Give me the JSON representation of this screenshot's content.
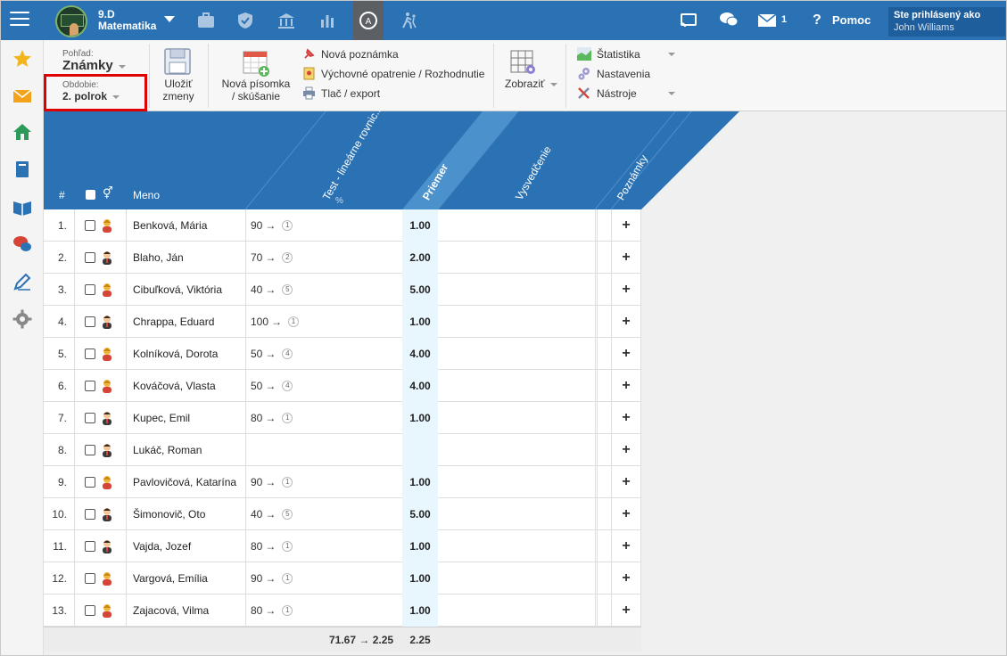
{
  "header": {
    "class_name_line1": "9.D",
    "class_name_line2": "Matematika",
    "messages_count": "1",
    "help_label": "Pomoc",
    "user_label": "Ste prihlásený ako",
    "user_name": "John Williams"
  },
  "toolbar": {
    "view_label": "Pohľad:",
    "view_value": "Známky",
    "period_label": "Obdobie:",
    "period_value": "2. polrok",
    "save_line1": "Uložiť",
    "save_line2": "zmeny",
    "new_test_line1": "Nová písomka",
    "new_test_line2": "/ skúšanie",
    "new_note": "Nová poznámka",
    "edu_measure": "Výchovné opatrenie / Rozhodnutie",
    "print_export": "Tlač / export",
    "show_label": "Zobraziť",
    "statistics": "Štatistika",
    "settings": "Nastavenia",
    "tools": "Nástroje"
  },
  "columns": {
    "num": "#",
    "name": "Meno",
    "test": "Test - lineárne rovnic...",
    "avg": "Priemer",
    "report": "Vysvedčenie",
    "notes": "Poznámky"
  },
  "students": [
    {
      "num": "1.",
      "name": "Benková, Mária",
      "points": "90",
      "grade": "1",
      "avg": "1.00",
      "gender": "female"
    },
    {
      "num": "2.",
      "name": "Blaho, Ján",
      "points": "70",
      "grade": "2",
      "avg": "2.00",
      "gender": "male"
    },
    {
      "num": "3.",
      "name": "Cibuľková, Viktória",
      "points": "40",
      "grade": "5",
      "avg": "5.00",
      "gender": "female"
    },
    {
      "num": "4.",
      "name": "Chrappa, Eduard",
      "points": "100",
      "grade": "1",
      "avg": "1.00",
      "gender": "male"
    },
    {
      "num": "5.",
      "name": "Kolníková, Dorota",
      "points": "50",
      "grade": "4",
      "avg": "4.00",
      "gender": "female"
    },
    {
      "num": "6.",
      "name": "Kováčová, Vlasta",
      "points": "50",
      "grade": "4",
      "avg": "4.00",
      "gender": "female"
    },
    {
      "num": "7.",
      "name": "Kupec, Emil",
      "points": "80",
      "grade": "1",
      "avg": "1.00",
      "gender": "male"
    },
    {
      "num": "8.",
      "name": "Lukáč, Roman",
      "points": "",
      "grade": "",
      "avg": "",
      "gender": "male"
    },
    {
      "num": "9.",
      "name": "Pavlovičová, Katarína",
      "points": "90",
      "grade": "1",
      "avg": "1.00",
      "gender": "female"
    },
    {
      "num": "10.",
      "name": "Šimonovič, Oto",
      "points": "40",
      "grade": "5",
      "avg": "5.00",
      "gender": "male"
    },
    {
      "num": "11.",
      "name": "Vajda, Jozef",
      "points": "80",
      "grade": "1",
      "avg": "1.00",
      "gender": "male"
    },
    {
      "num": "12.",
      "name": "Vargová, Emília",
      "points": "90",
      "grade": "1",
      "avg": "1.00",
      "gender": "female"
    },
    {
      "num": "13.",
      "name": "Zajacová, Vilma",
      "points": "80",
      "grade": "1",
      "avg": "1.00",
      "gender": "female"
    }
  ],
  "footer": {
    "sum": "71.67 → 2.25",
    "avg": "2.25"
  },
  "colors": {
    "topbar": "#2b72b5",
    "header": "#2b72b5",
    "avg_col": "#e8f6fd",
    "highlight": "#e00000"
  }
}
